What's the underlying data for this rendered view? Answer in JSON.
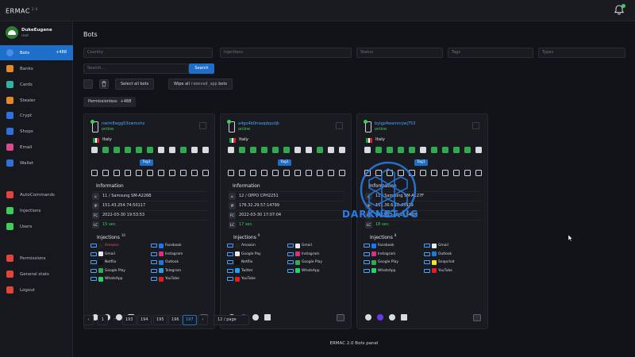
{
  "app": {
    "brand": "ERMAC",
    "version": "2.0"
  },
  "user": {
    "name": "DukeEugene",
    "role": "root"
  },
  "sidebar": {
    "items": [
      {
        "label": "Bots",
        "badge": "+488",
        "active": true,
        "icon": "bots-icon",
        "color": "#e0453a"
      },
      {
        "label": "Banks",
        "icon": "bank-icon",
        "color": "#e08a2a"
      },
      {
        "label": "Cards",
        "icon": "cards-icon",
        "color": "#2fb3a8"
      },
      {
        "label": "Stealer",
        "icon": "stealer-icon",
        "color": "#e08a2a"
      },
      {
        "label": "Crypt",
        "icon": "crypt-icon",
        "color": "#2f6fe0"
      },
      {
        "label": "Shops",
        "icon": "shops-icon",
        "color": "#2f6fe0"
      },
      {
        "label": "Email",
        "icon": "email-icon",
        "color": "#d84a8a"
      },
      {
        "label": "Wallet",
        "icon": "wallet-icon",
        "color": "#2f6fe0"
      },
      {
        "label": "AutoCommands",
        "icon": "autocommands-icon",
        "color": "#e0453a"
      },
      {
        "label": "Injections",
        "icon": "injections-icon",
        "color": "#3ecf5a"
      },
      {
        "label": "Users",
        "icon": "users-icon",
        "color": "#3ecf5a"
      },
      {
        "label": "Permissions",
        "icon": "permissions-icon",
        "color": "#e0453a"
      },
      {
        "label": "General stats",
        "icon": "stats-icon",
        "color": "#e0453a"
      },
      {
        "label": "Logout",
        "icon": "logout-icon",
        "color": "#e0453a"
      }
    ]
  },
  "page": {
    "title": "Bots"
  },
  "filters": {
    "country": "Country",
    "injections": "Injections",
    "status": "Status",
    "tags": "Tags",
    "types": "Types"
  },
  "search": {
    "placeholder": "Search...",
    "button": "Search"
  },
  "actions": {
    "select_all": "Select all bots",
    "wipe_prefix": "Wipe all",
    "wipe_code": "removed_app",
    "wipe_suffix": "bots"
  },
  "permissions_pill": {
    "label": "Permissionless",
    "count": "+488"
  },
  "bots": [
    {
      "id": "nwlm8wgg53owmxhz",
      "status": "online",
      "country": "Italy",
      "tag": "Tag1",
      "info_title": "Information",
      "device": "11 / Samsung SM-A226B",
      "ip": "151.43.254.74:50117",
      "first_connect": "2022-03-30 19:53:53",
      "last_connect": "15 sec.",
      "injections_title": "Injections",
      "injections_count": "10",
      "injections": [
        {
          "name": "Amazon",
          "red": true
        },
        {
          "name": "Facebook"
        },
        {
          "name": "Gmail"
        },
        {
          "name": "Instagram"
        },
        {
          "name": "Netflix"
        },
        {
          "name": "Outlook"
        },
        {
          "name": "Google Play"
        },
        {
          "name": "Telegram"
        },
        {
          "name": "WhatsApp"
        },
        {
          "name": "YouTube"
        }
      ]
    },
    {
      "id": "a4go4b0maopbputjk",
      "status": "online",
      "country": "Italy",
      "tag": "Tag1",
      "info_title": "Information",
      "device": "12 / OPPO CPH2251",
      "ip": "176.32.29.57:14799",
      "first_connect": "2022-03-30 17:07:04",
      "last_connect": "17 sec.",
      "injections_title": "Injections",
      "injections_count": "9",
      "injections": [
        {
          "name": "Amazon"
        },
        {
          "name": "Gmail"
        },
        {
          "name": "Google Pay"
        },
        {
          "name": "Instagram"
        },
        {
          "name": "Netflix"
        },
        {
          "name": "Google Play"
        },
        {
          "name": "Twitter"
        },
        {
          "name": "WhatsApp"
        },
        {
          "name": "YouTube"
        }
      ]
    },
    {
      "id": "bylgp4wamncjwj753",
      "status": "online",
      "country": "Italy",
      "tag": "Tag1",
      "info_title": "Information",
      "device": "11 / Samsung SM-A127F",
      "ip": "151.36.6.10:45919",
      "first_connect": "2022-03-30 16:54:07",
      "last_connect": "18 sec.",
      "injections_title": "Injections",
      "injections_count": "8",
      "injections": [
        {
          "name": "Facebook"
        },
        {
          "name": "Gmail"
        },
        {
          "name": "Instagram"
        },
        {
          "name": "Outlook"
        },
        {
          "name": "Google Play"
        },
        {
          "name": "Snapchat"
        },
        {
          "name": "WhatsApp"
        },
        {
          "name": "YouTube"
        }
      ]
    }
  ],
  "info_keys": {
    "device": "⌂",
    "ip": "IP",
    "first": "FC",
    "last": "LC"
  },
  "pagination": {
    "prev": "‹",
    "pages": [
      "1",
      "···",
      "193",
      "194",
      "195",
      "196",
      "197"
    ],
    "current": "197",
    "next": "›",
    "per_page": "12 / page"
  },
  "footer": "ERMAC 2.0 Bots panel",
  "watermark": "DARKNET.UG"
}
